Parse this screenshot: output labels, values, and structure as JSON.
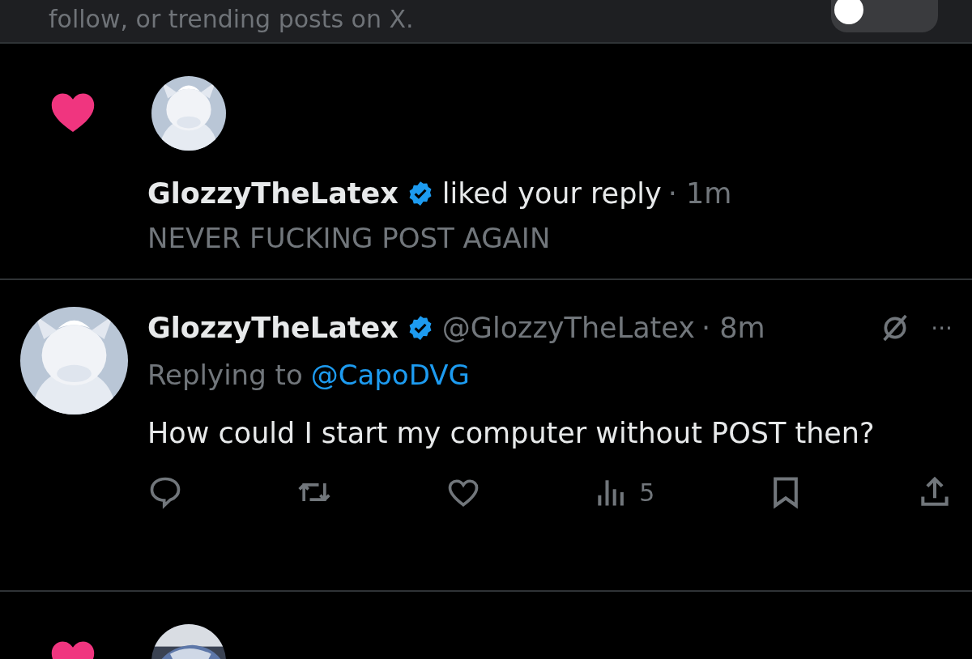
{
  "banner": {
    "text": "follow, or trending posts on X.",
    "toggle": {
      "on": false
    }
  },
  "feed": [
    {
      "kind": "like",
      "user": {
        "name": "GlozzyTheLatex",
        "verified": true
      },
      "action": "liked your reply",
      "time": "· 1m",
      "text": "NEVER FUCKING POST AGAIN"
    },
    {
      "kind": "post",
      "user": {
        "name": "GlozzyTheLatex",
        "verified": true
      },
      "handle": "@GlozzyTheLatex",
      "time": "· 8m",
      "replying": "Replying to",
      "mention": "@CapoDVG",
      "more": "···",
      "text": "How could I start my computer without POST then?",
      "actions": [
        {
          "kind": "reply"
        },
        {
          "kind": "repost"
        },
        {
          "kind": "like"
        },
        {
          "kind": "views",
          "count": "5"
        },
        {
          "kind": "bookmark"
        },
        {
          "kind": "share"
        }
      ]
    },
    {
      "kind": "like"
    }
  ]
}
